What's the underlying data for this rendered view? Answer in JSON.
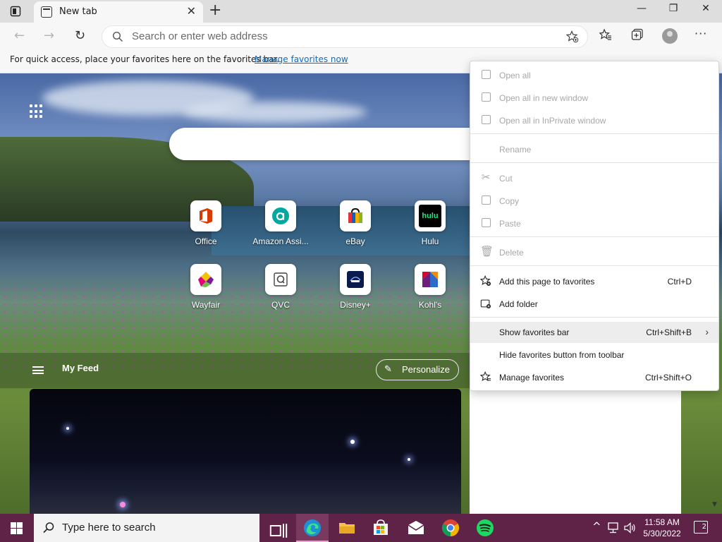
{
  "window": {
    "tab_title": "New tab",
    "tab_close": "✕",
    "new_tab": "+",
    "minimize": "—",
    "restore": "❐",
    "close": "✕"
  },
  "toolbar": {
    "back": "←",
    "forward": "→",
    "refresh": "↻",
    "address_placeholder": "Search or enter web address",
    "more": "···"
  },
  "favorites_bar": {
    "message": "For quick access, place your favorites here on the favorites bar.",
    "manage_link": "Manage favorites now"
  },
  "quick_links": [
    {
      "label": "Office",
      "icon": "office-icon",
      "color": "#d83b01"
    },
    {
      "label": "Amazon Assi...",
      "icon": "amazon-assistant-icon",
      "color": "#00a8a0"
    },
    {
      "label": "eBay",
      "icon": "ebay-icon",
      "color": "#e53238"
    },
    {
      "label": "Hulu",
      "icon": "hulu-icon",
      "color": "#1ce783"
    },
    {
      "label": "Wayfair",
      "icon": "wayfair-icon",
      "color": "#7b189f"
    },
    {
      "label": "QVC",
      "icon": "qvc-icon",
      "color": "#444444"
    },
    {
      "label": "Disney+",
      "icon": "disney-plus-icon",
      "color": "#0c1b4d"
    },
    {
      "label": "Kohl's",
      "icon": "kohls-icon",
      "color": "#8b1d3f"
    }
  ],
  "hulu_text": "hulu",
  "feed": {
    "title": "My Feed",
    "personalize": "Personalize"
  },
  "context_menu": {
    "items": [
      {
        "label": "Open all",
        "shortcut": "",
        "enabled": false
      },
      {
        "label": "Open all in new window",
        "shortcut": "",
        "enabled": false
      },
      {
        "label": "Open all in InPrivate window",
        "shortcut": "",
        "enabled": false
      },
      {
        "label": "Rename",
        "shortcut": "",
        "enabled": false
      },
      {
        "label": "Cut",
        "shortcut": "",
        "enabled": false
      },
      {
        "label": "Copy",
        "shortcut": "",
        "enabled": false
      },
      {
        "label": "Paste",
        "shortcut": "",
        "enabled": false
      },
      {
        "label": "Delete",
        "shortcut": "",
        "enabled": false
      },
      {
        "label": "Add this page to favorites",
        "shortcut": "Ctrl+D",
        "enabled": true
      },
      {
        "label": "Add folder",
        "shortcut": "",
        "enabled": true
      },
      {
        "label": "Show favorites bar",
        "shortcut": "Ctrl+Shift+B",
        "enabled": true
      },
      {
        "label": "Hide favorites button from toolbar",
        "shortcut": "",
        "enabled": true
      },
      {
        "label": "Manage favorites",
        "shortcut": "Ctrl+Shift+O",
        "enabled": true
      }
    ],
    "submenu_arrow": "›"
  },
  "taskbar": {
    "search_placeholder": "Type here to search",
    "time": "11:58 AM",
    "date": "5/30/2022",
    "notifications": "2",
    "tray_chevron": "^"
  },
  "colors": {
    "taskbar": "#5e2347",
    "link": "#0f6cbd",
    "disabled_text": "#a8a8a8"
  }
}
